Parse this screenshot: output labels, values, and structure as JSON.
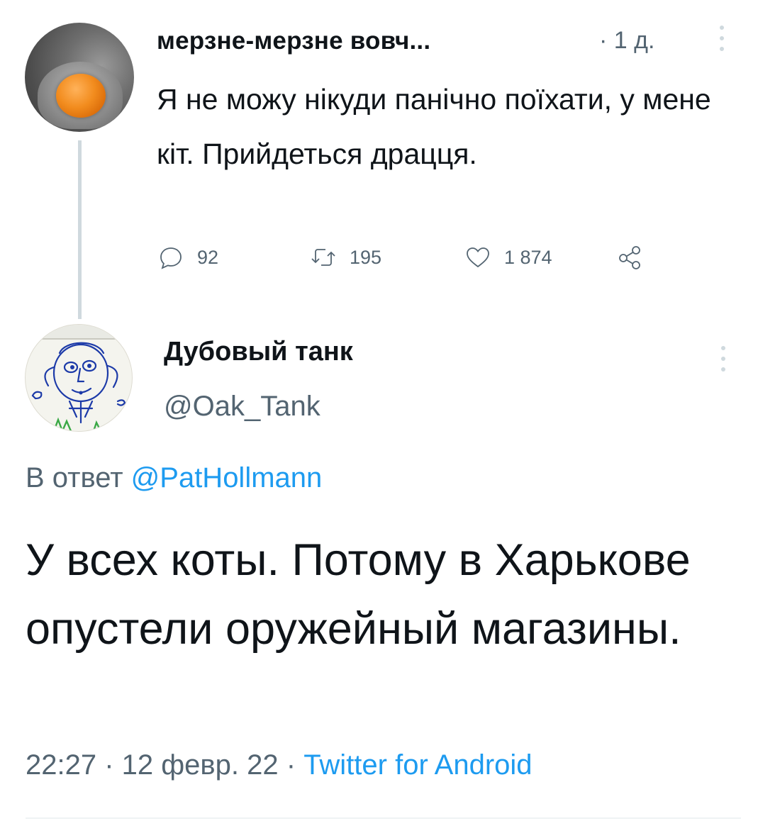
{
  "parent_tweet": {
    "display_name": "мерзне-мерзне вовч...",
    "time": "· 1 д.",
    "text": "Я не можу нікуди панічно поїхати, у мене кіт. Прийдеться драцця.",
    "avatar_icon": "orange-in-hand-avatar",
    "actions": {
      "replies": "92",
      "retweets": "195",
      "likes": "1 874",
      "reply_icon": "comment-icon",
      "retweet_icon": "retweet-icon",
      "like_icon": "heart-icon",
      "share_icon": "share-icon"
    }
  },
  "reply_tweet": {
    "display_name": "Дубовый танк",
    "handle": "@Oak_Tank",
    "avatar_icon": "child-drawing-avatar",
    "replying_prefix": "В ответ",
    "replying_to": "@PatHollmann",
    "text": "У всех коты. Потому в Харькове опустели оружейный магазины.",
    "timestamp": "22:27 · 12 февр. 22 ·",
    "source": "Twitter for Android"
  },
  "colors": {
    "text_primary": "#0f1419",
    "text_secondary": "#536471",
    "link": "#1d9bf0",
    "thread_line": "#cfd9de"
  }
}
